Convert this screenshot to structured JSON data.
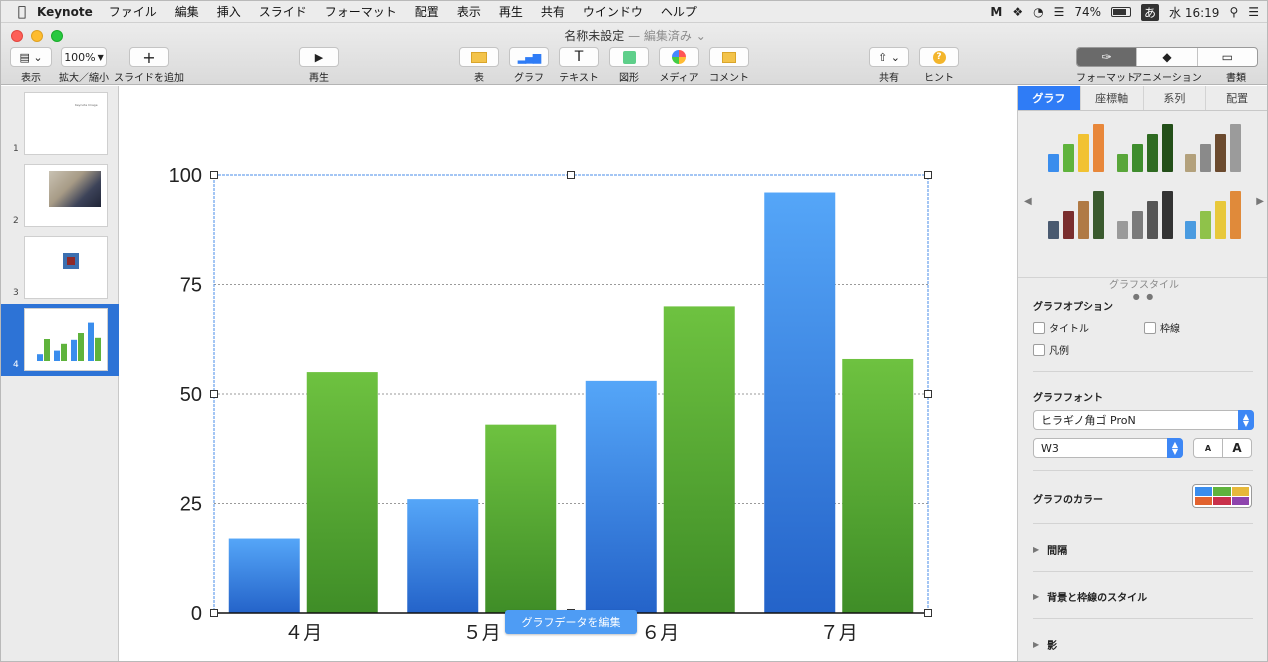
{
  "menubar": {
    "app": "Keynote",
    "items": [
      "ファイル",
      "編集",
      "挿入",
      "スライド",
      "フォーマット",
      "配置",
      "表示",
      "再生",
      "共有",
      "ウインドウ",
      "ヘルプ"
    ],
    "battery": "74%",
    "input_mode": "あ",
    "clock": "水 16:19"
  },
  "window": {
    "title": "名称未設定",
    "edited": "— 編集済み ⌄"
  },
  "toolbar": {
    "view_label": "表示",
    "zoom_value": "100%",
    "zoom_label": "拡大／縮小",
    "add_slide_label": "スライドを追加",
    "play_label": "再生",
    "table_label": "表",
    "chart_label": "グラフ",
    "text_label": "テキスト",
    "shape_label": "図形",
    "media_label": "メディア",
    "comment_label": "コメント",
    "share_label": "共有",
    "hint_label": "ヒント",
    "format_label": "フォーマット",
    "animate_label": "アニメーション",
    "document_label": "書類"
  },
  "slides": [
    {
      "num": "1",
      "thumb_text": "Keynote  Image"
    },
    {
      "num": "2"
    },
    {
      "num": "3"
    },
    {
      "num": "4",
      "selected": true
    }
  ],
  "chart_data": {
    "type": "bar",
    "categories": [
      "４月",
      "５月",
      "６月",
      "７月"
    ],
    "series": [
      {
        "values": [
          17,
          26,
          53,
          96
        ],
        "color": "#3a8ded"
      },
      {
        "values": [
          55,
          43,
          70,
          58
        ],
        "color": "#5fb33c"
      }
    ],
    "ylim": [
      0,
      100
    ],
    "yticks": [
      "0",
      "25",
      "50",
      "75",
      "100"
    ],
    "grid": true,
    "legend": "none"
  },
  "edit_chart_button": "グラフデータを編集",
  "inspector": {
    "tabs": [
      "グラフ",
      "座標軸",
      "系列",
      "配置"
    ],
    "style_caption": "グラフスタイル",
    "options_title": "グラフオプション",
    "opt_title": "タイトル",
    "opt_border": "枠線",
    "opt_legend": "凡例",
    "font_title": "グラフフォント",
    "font_family": "ヒラギノ角ゴ ProN",
    "font_weight": "W3",
    "font_smaller": "A",
    "font_larger": "A",
    "color_title": "グラフのカラー",
    "gap": "間隔",
    "bg_border": "背景と枠線のスタイル",
    "shadow": "影",
    "chart_colors": [
      "#3a8ded",
      "#5fb33c",
      "#e6b83a",
      "#e2622e",
      "#c9304a",
      "#8e44ad"
    ]
  }
}
